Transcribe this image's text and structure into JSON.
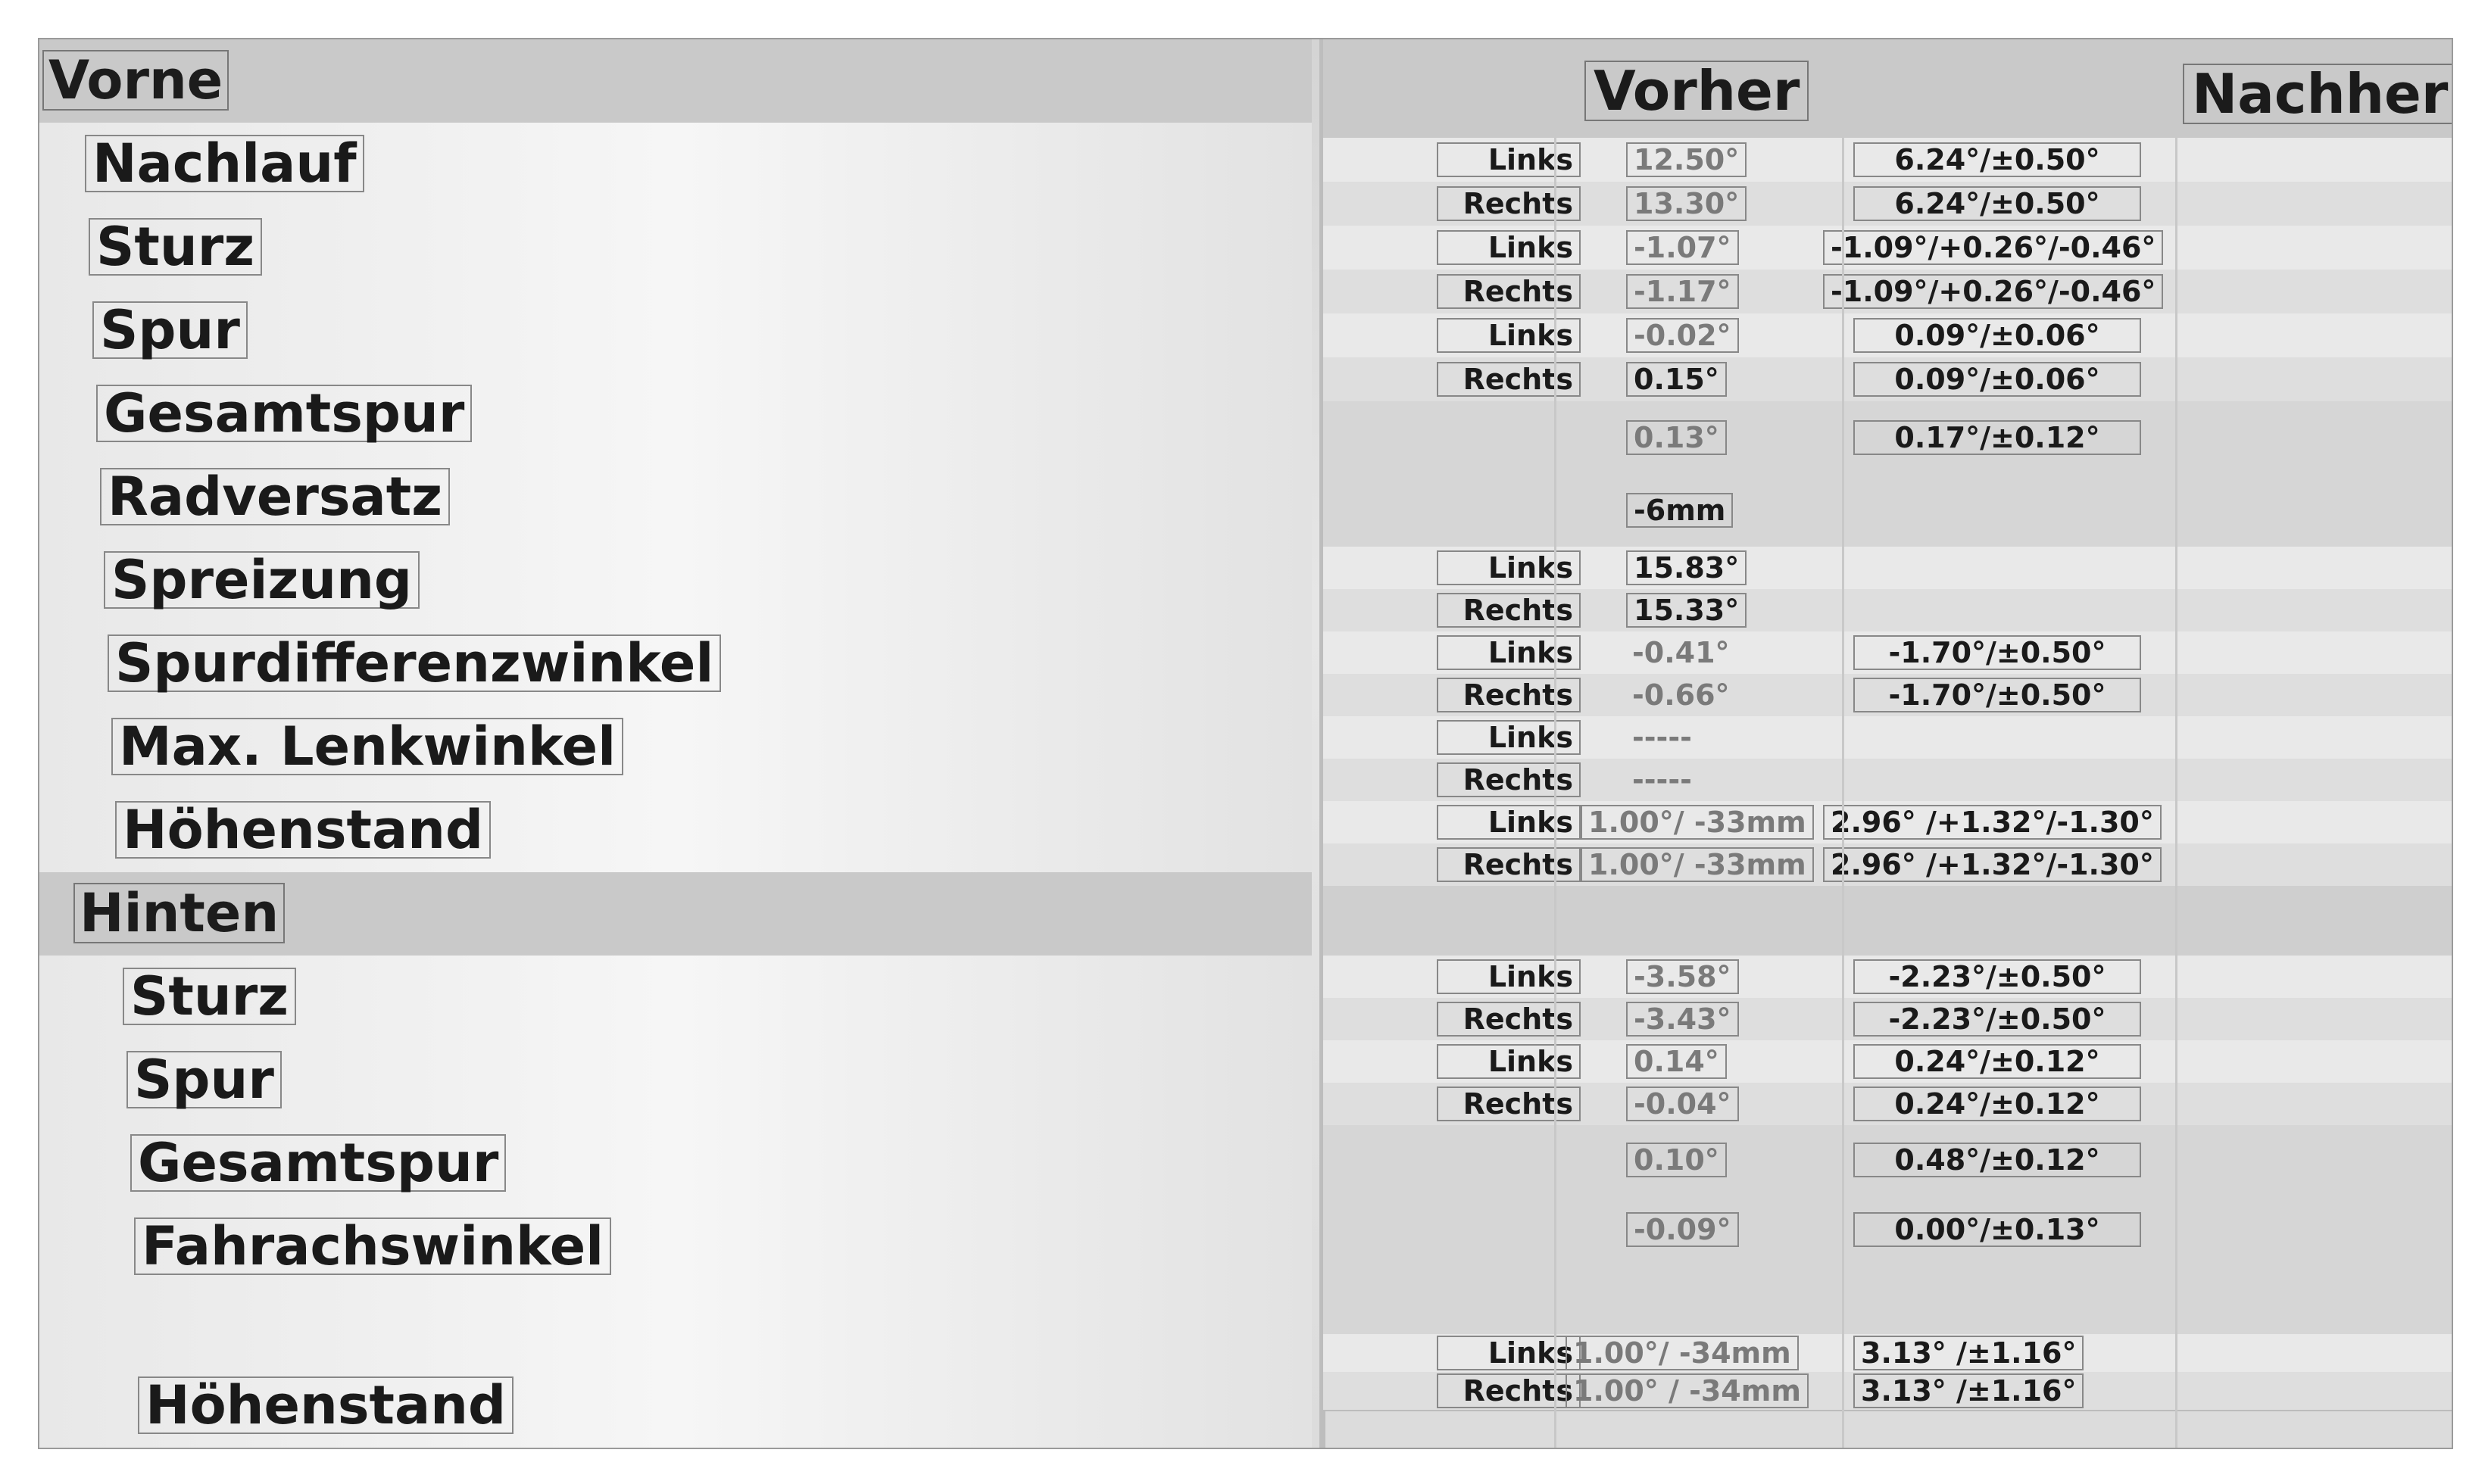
{
  "front": {
    "title": "Vorne",
    "labels": [
      "Nachlauf",
      "Sturz",
      "Spur",
      "Gesamtspur",
      "Radversatz",
      "Spreizung",
      "Spurdifferenzwinkel",
      "Max. Lenkwinkel",
      "Höhenstand"
    ]
  },
  "rear": {
    "title": "Hinten",
    "labels": [
      "Sturz",
      "Spur",
      "Gesamtspur",
      "Fahrachswinkel",
      "Höhenstand"
    ]
  },
  "columns": {
    "before": "Vorher",
    "after": "Nachher"
  },
  "front_rows": [
    {
      "side": "Links",
      "before": "12.50°",
      "after": "6.24°/±0.50°"
    },
    {
      "side": "Rechts",
      "before": "13.30°",
      "after": "6.24°/±0.50°"
    },
    {
      "side": "Links",
      "before": "-1.07°",
      "after": "-1.09°/+0.26°/-0.46°"
    },
    {
      "side": "Rechts",
      "before": "-1.17°",
      "after": "-1.09°/+0.26°/-0.46°"
    },
    {
      "side": "Links",
      "before": "-0.02°",
      "after": "0.09°/±0.06°"
    },
    {
      "side": "Rechts",
      "before": "0.15°",
      "after": "0.09°/±0.06°"
    },
    {
      "side": "",
      "before": "0.13°",
      "after": "0.17°/±0.12°"
    },
    {
      "side": "",
      "before": "-6mm",
      "after": ""
    },
    {
      "side": "Links",
      "before": "15.83°",
      "after": ""
    },
    {
      "side": "Rechts",
      "before": "15.33°",
      "after": ""
    },
    {
      "side": "Links",
      "before": "-0.41°",
      "after": "-1.70°/±0.50°"
    },
    {
      "side": "Rechts",
      "before": "-0.66°",
      "after": "-1.70°/±0.50°"
    },
    {
      "side": "Links",
      "before": "-----",
      "after": ""
    },
    {
      "side": "Rechts",
      "before": "-----",
      "after": ""
    },
    {
      "side": "Links",
      "before": "1.00°/ -33mm",
      "after": "2.96° /+1.32°/-1.30°"
    },
    {
      "side": "Rechts",
      "before": "1.00°/ -33mm",
      "after": "2.96° /+1.32°/-1.30°"
    }
  ],
  "rear_rows": [
    {
      "side": "Links",
      "before": "-3.58°",
      "after": "-2.23°/±0.50°"
    },
    {
      "side": "Rechts",
      "before": "-3.43°",
      "after": "-2.23°/±0.50°"
    },
    {
      "side": "Links",
      "before": "0.14°",
      "after": "0.24°/±0.12°"
    },
    {
      "side": "Rechts",
      "before": "-0.04°",
      "after": "0.24°/±0.12°"
    },
    {
      "side": "",
      "before": "0.10°",
      "after": "0.48°/±0.12°"
    },
    {
      "side": "",
      "before": "-0.09°",
      "after": "0.00°/±0.13°"
    },
    {
      "side": "",
      "before": "",
      "after": ""
    },
    {
      "side": "Links",
      "before": "1.00°/ -34mm",
      "after": "3.13° /±1.16°"
    },
    {
      "side": "Rechts",
      "before": "1.00° / -34mm",
      "after": "3.13° /±1.16°"
    }
  ]
}
